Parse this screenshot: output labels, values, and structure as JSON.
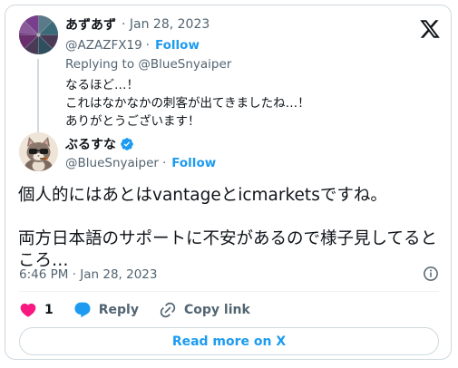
{
  "parent_tweet": {
    "display_name": "あずあず",
    "date": "· Jan 28, 2023",
    "handle": "@AZAZFX19",
    "follow_sep": "·",
    "follow_label": "Follow",
    "replying_to": "Replying to @BlueSnyaiper",
    "lines": [
      "なるほど…！",
      "これはなかなかの刺客が出てきましたね…！",
      "ありがとうございます！"
    ]
  },
  "main_tweet": {
    "display_name": "ぶるすな",
    "handle": "@BlueSnyaiper",
    "follow_sep": "·",
    "follow_label": "Follow",
    "paragraph1": "個人的にはあとはvantageとicmarketsですね。",
    "paragraph2_line1": "両方日本語のサポートに不安があるので様子見してると",
    "paragraph2_line2": "ころ…",
    "timestamp": "6:46 PM · Jan 28, 2023"
  },
  "actions": {
    "like_count": "1",
    "reply_label": "Reply",
    "copy_link_label": "Copy link"
  },
  "read_more_label": "Read more on X",
  "colors": {
    "accent": "#1d9bf0",
    "like": "#f91880",
    "secondary_text": "#536471",
    "border": "#cfd9de"
  },
  "icons": {
    "logo": "x-logo-icon",
    "verified": "verified-badge-icon",
    "info": "info-icon",
    "like": "heart-icon",
    "reply": "speech-bubble-icon",
    "copy": "link-icon"
  }
}
